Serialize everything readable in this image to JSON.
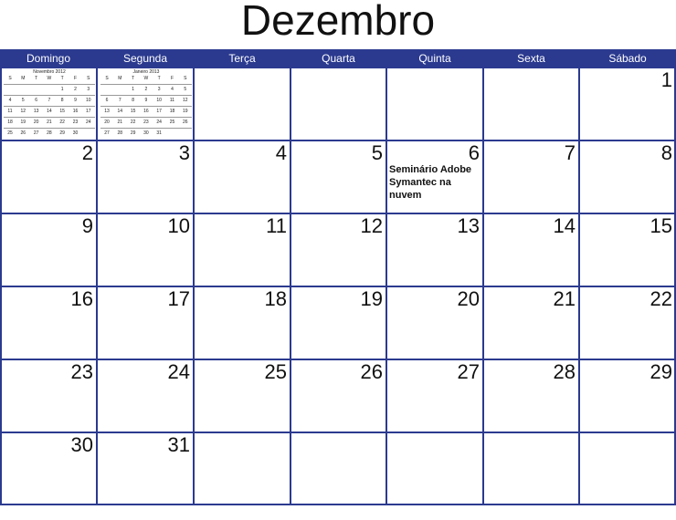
{
  "title": "Dezembro",
  "weekdays": [
    "Domingo",
    "Segunda",
    "Terça",
    "Quarta",
    "Quinta",
    "Sexta",
    "Sábado"
  ],
  "weeks": [
    [
      "",
      "",
      "",
      "",
      "",
      "",
      "1"
    ],
    [
      "2",
      "3",
      "4",
      "5",
      "6",
      "7",
      "8"
    ],
    [
      "9",
      "10",
      "11",
      "12",
      "13",
      "14",
      "15"
    ],
    [
      "16",
      "17",
      "18",
      "19",
      "20",
      "21",
      "22"
    ],
    [
      "23",
      "24",
      "25",
      "26",
      "27",
      "28",
      "29"
    ],
    [
      "30",
      "31",
      "",
      "",
      "",
      "",
      ""
    ]
  ],
  "events": [
    {
      "week": 1,
      "day": 4,
      "text": "Seminário Adobe Symantec na nuvem"
    }
  ],
  "mini_calendars": [
    {
      "title": "Novembro 2012",
      "weekday_initials": [
        "S",
        "M",
        "T",
        "W",
        "T",
        "F",
        "S"
      ],
      "rows": [
        [
          "",
          "",
          "",
          "",
          "1",
          "2",
          "3"
        ],
        [
          "4",
          "5",
          "6",
          "7",
          "8",
          "9",
          "10"
        ],
        [
          "11",
          "12",
          "13",
          "14",
          "15",
          "16",
          "17"
        ],
        [
          "18",
          "19",
          "20",
          "21",
          "22",
          "23",
          "24"
        ],
        [
          "25",
          "26",
          "27",
          "28",
          "29",
          "30",
          ""
        ]
      ]
    },
    {
      "title": "Janeiro 2013",
      "weekday_initials": [
        "S",
        "M",
        "T",
        "W",
        "T",
        "F",
        "S"
      ],
      "rows": [
        [
          "",
          "",
          "1",
          "2",
          "3",
          "4",
          "5"
        ],
        [
          "6",
          "7",
          "8",
          "9",
          "10",
          "11",
          "12"
        ],
        [
          "13",
          "14",
          "15",
          "16",
          "17",
          "18",
          "19"
        ],
        [
          "20",
          "21",
          "22",
          "23",
          "24",
          "25",
          "26"
        ],
        [
          "27",
          "28",
          "29",
          "30",
          "31",
          "",
          ""
        ]
      ]
    }
  ],
  "colors": {
    "header_bg": "#2b3a8f",
    "grid_line": "#2b3a8f",
    "header_text": "#ffffff"
  }
}
